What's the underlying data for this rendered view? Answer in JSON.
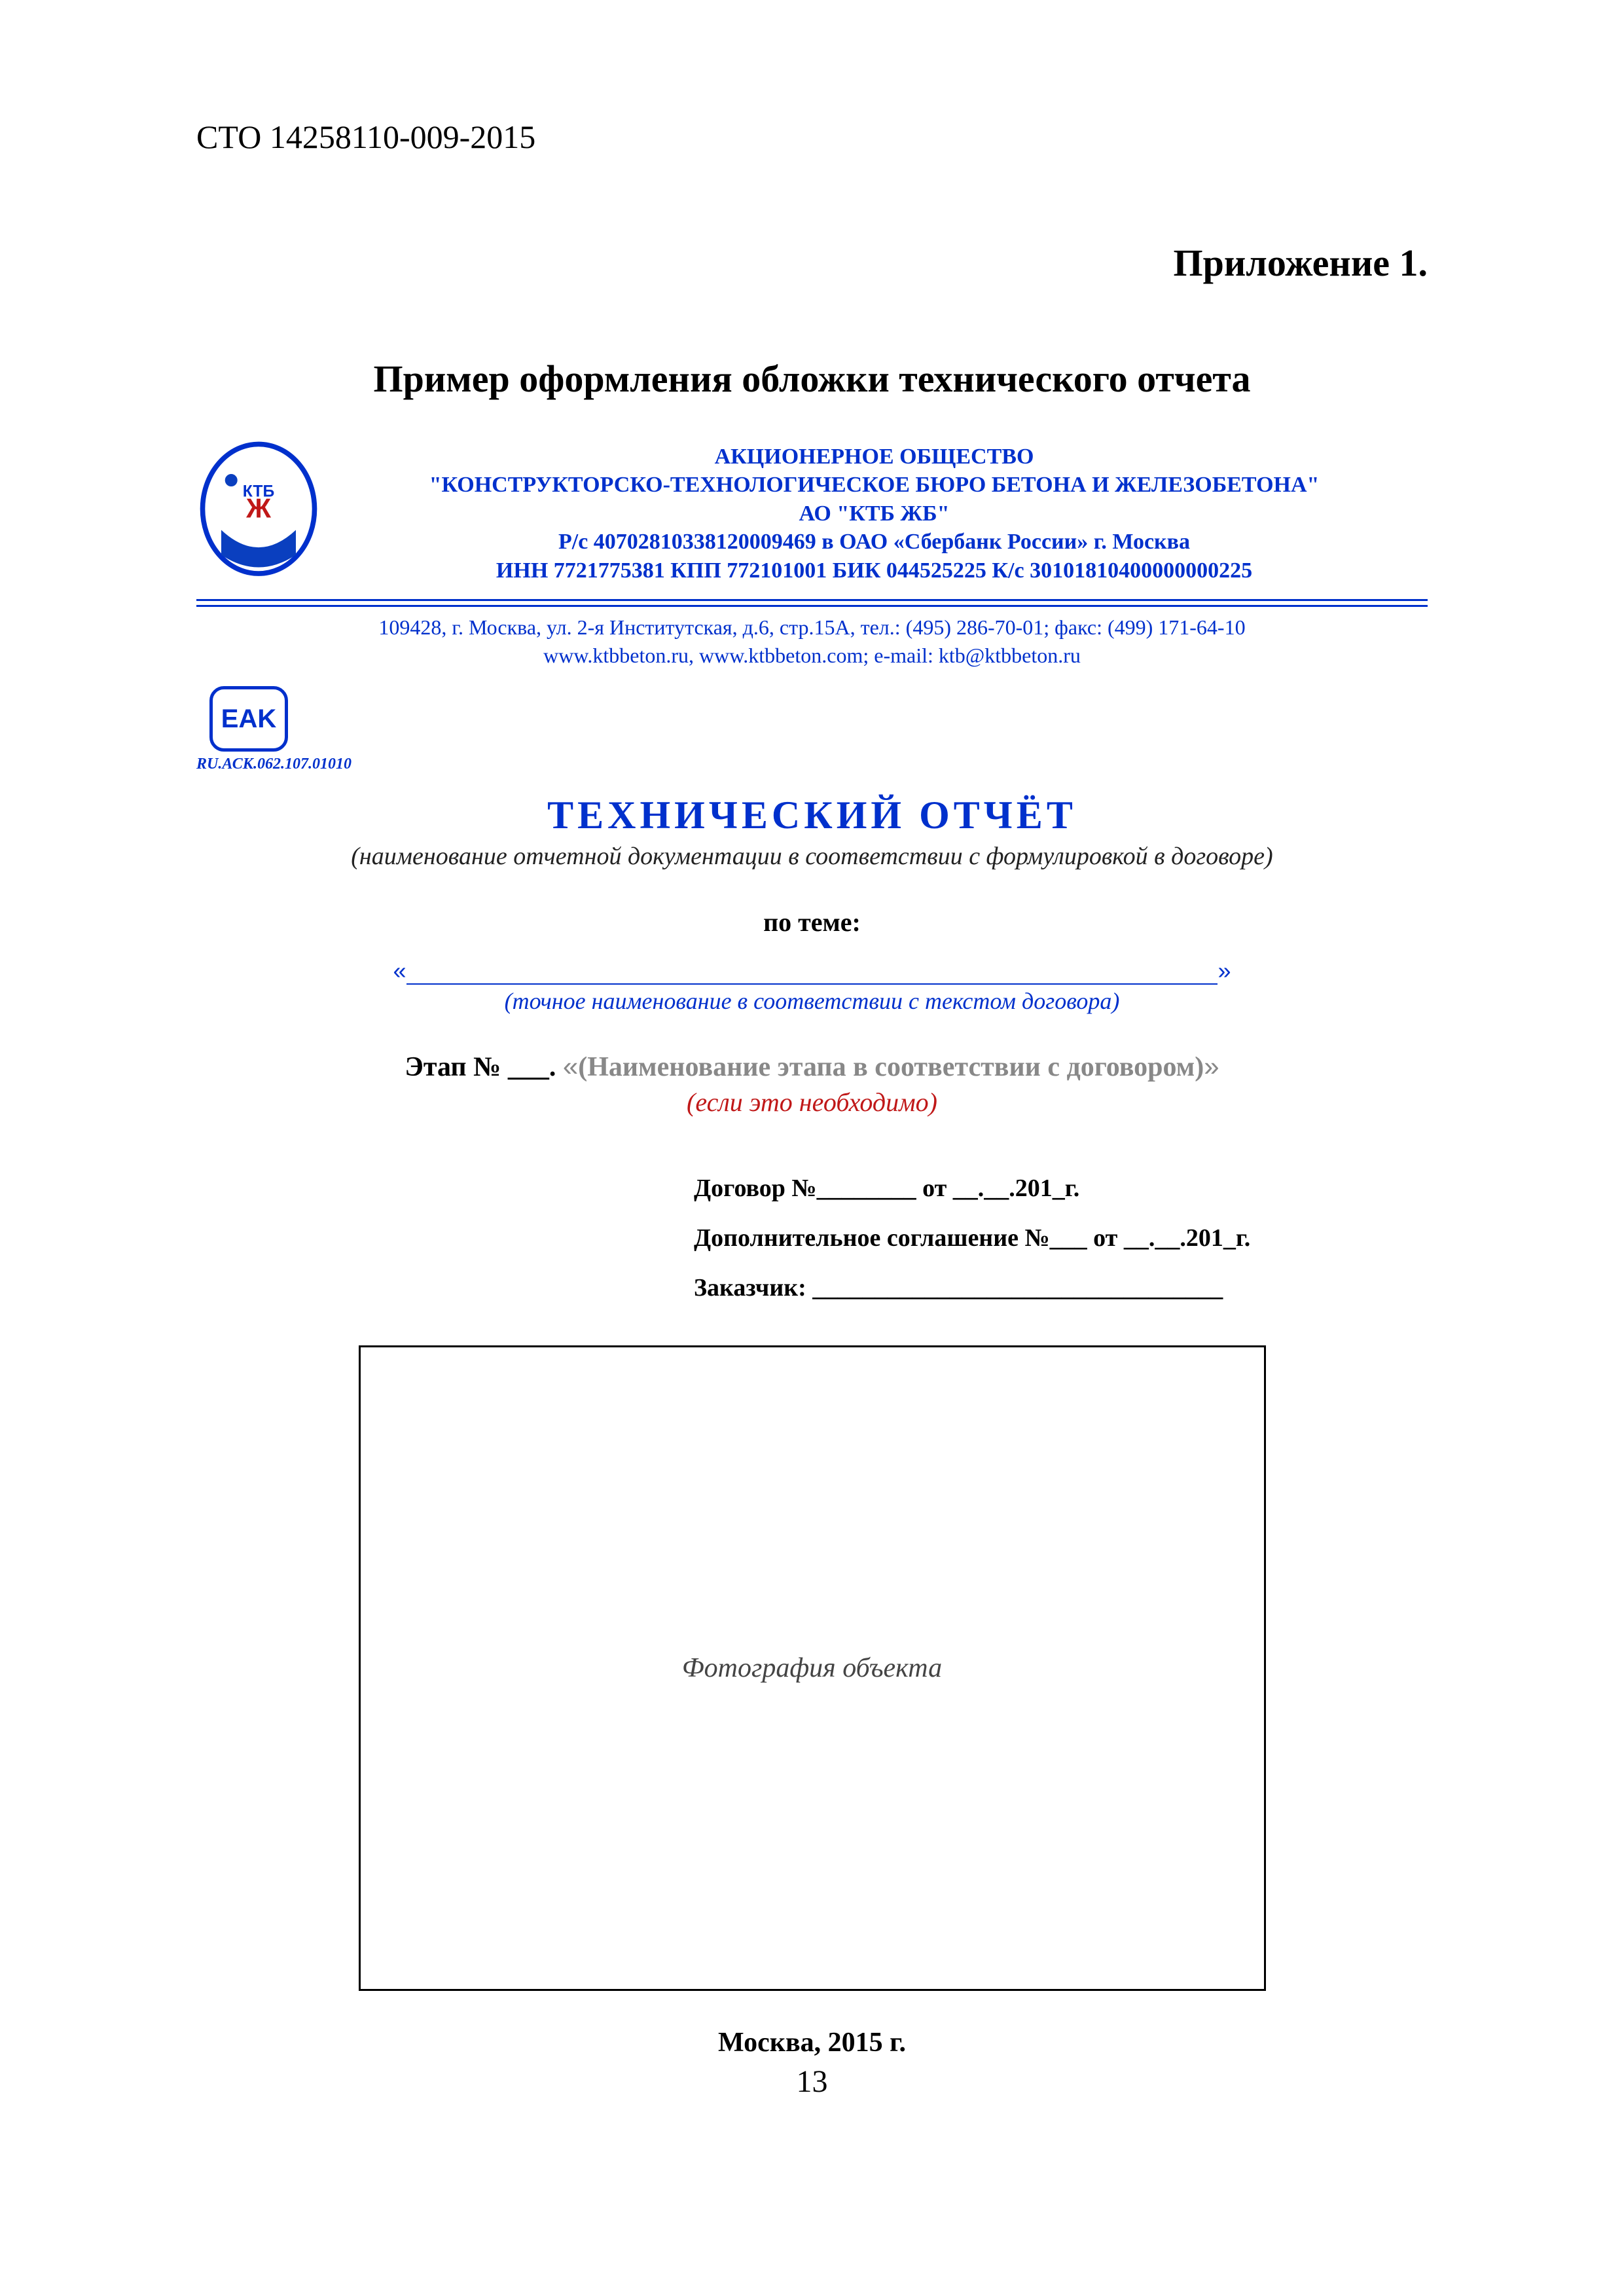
{
  "header": {
    "code": "СТО 14258110-009-2015"
  },
  "appendix": {
    "title": "Приложение 1."
  },
  "example": {
    "heading": "Пример оформления обложки технического отчета"
  },
  "org": {
    "line1": "АКЦИОНЕРНОЕ ОБЩЕСТВО",
    "line2": "\"КОНСТРУКТОРСКО-ТЕХНОЛОГИЧЕСКОЕ  БЮРО  БЕТОНА  И  ЖЕЛЕЗОБЕТОНА\"",
    "line3": "АО \"КТБ  ЖБ\"",
    "line4": "Р/с 40702810338120009469 в ОАО «Сбербанк России» г. Москва",
    "line5": "ИНН 7721775381  КПП 772101001  БИК 044525225  К/с 30101810400000000225"
  },
  "contacts": {
    "line1": "109428, г. Москва, ул. 2-я Институтская,  д.6, стр.15А, тел.: (495) 286-70-01;  факс: (499) 171-64-10",
    "line2": "www.ktbbeton.ru, www.ktbbeton.com;  e-mail: ktb@ktbbeton.ru"
  },
  "eak": {
    "label": "EAK",
    "code": "RU.АСК.062.107.01010"
  },
  "report": {
    "title": "ТЕХНИЧЕСКИЙ  ОТЧЁТ",
    "subtitle": "(наименование отчетной документации в соответствии с формулировкой в договоре)",
    "by_topic": "по теме:",
    "quote_open": "«",
    "quote_close": "»",
    "topic_caption": "(точное наименование в соответствии с текстом договора)"
  },
  "stage": {
    "prefix": "Этап № ___. ",
    "q_open": "«",
    "name": "(Наименование этапа в соответствии с договором)",
    "q_close": "»",
    "note": "(если это необходимо)"
  },
  "contract": {
    "line1": "Договор №________ от __.__.201_г.",
    "line2": "Дополнительное соглашение №___ от __.__.201_г.",
    "line3": "Заказчик: _________________________________"
  },
  "photo": {
    "placeholder": "Фотография объекта"
  },
  "footer": {
    "city_year": "Москва, 2015 г.",
    "page": "13"
  }
}
